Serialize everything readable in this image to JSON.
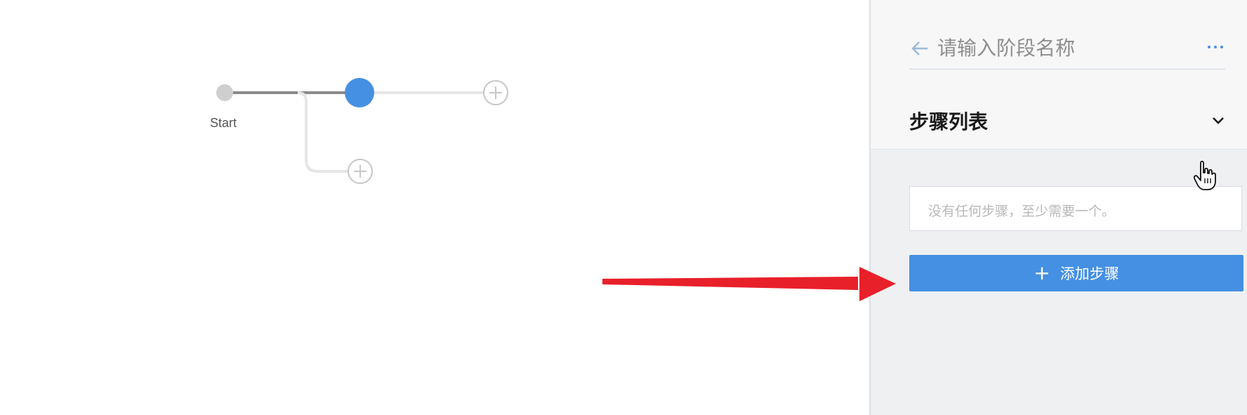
{
  "pipeline": {
    "start_label": "Start"
  },
  "stage_panel": {
    "stage_name_placeholder": "请输入阶段名称",
    "steps_section_title": "步骤列表",
    "empty_steps_message": "没有任何步骤，至少需要一个。",
    "add_step_label": "添加步骤"
  },
  "colors": {
    "accent": "#4590e2",
    "annotation_arrow": "#e8202a"
  },
  "icons": [
    "back-arrow-icon",
    "more-icon",
    "chevron-down-icon",
    "plus-icon",
    "hand-cursor-icon",
    "add-circle-icon"
  ]
}
